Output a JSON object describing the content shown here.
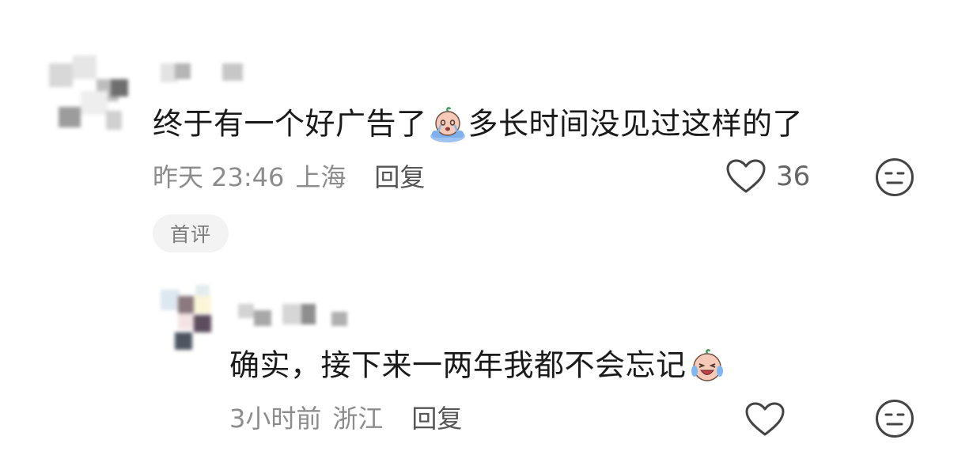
{
  "comments": [
    {
      "text_before": "终于有一个好广告了",
      "emoji": "crying-baby-emoji",
      "text_after": "多长时间没见过这样的了",
      "time": "昨天 23:46",
      "location": "上海",
      "reply_label": "回复",
      "likes": "36",
      "badge": "首评"
    },
    {
      "text_before": "确实，接下来一两年我都不会忘记",
      "emoji": "laughing-tears-baby-emoji",
      "time": "3小时前",
      "location": "浙江",
      "reply_label": "回复"
    }
  ],
  "icons": {
    "like": "heart-outline-icon",
    "dislike": "neutral-face-icon"
  },
  "colors": {
    "text": "#1a1a1a",
    "meta": "#8c8c8c",
    "reply": "#555555",
    "badge_bg": "#f3f3f3",
    "badge_text": "#7b7b7b",
    "icon_stroke": "#444444"
  }
}
